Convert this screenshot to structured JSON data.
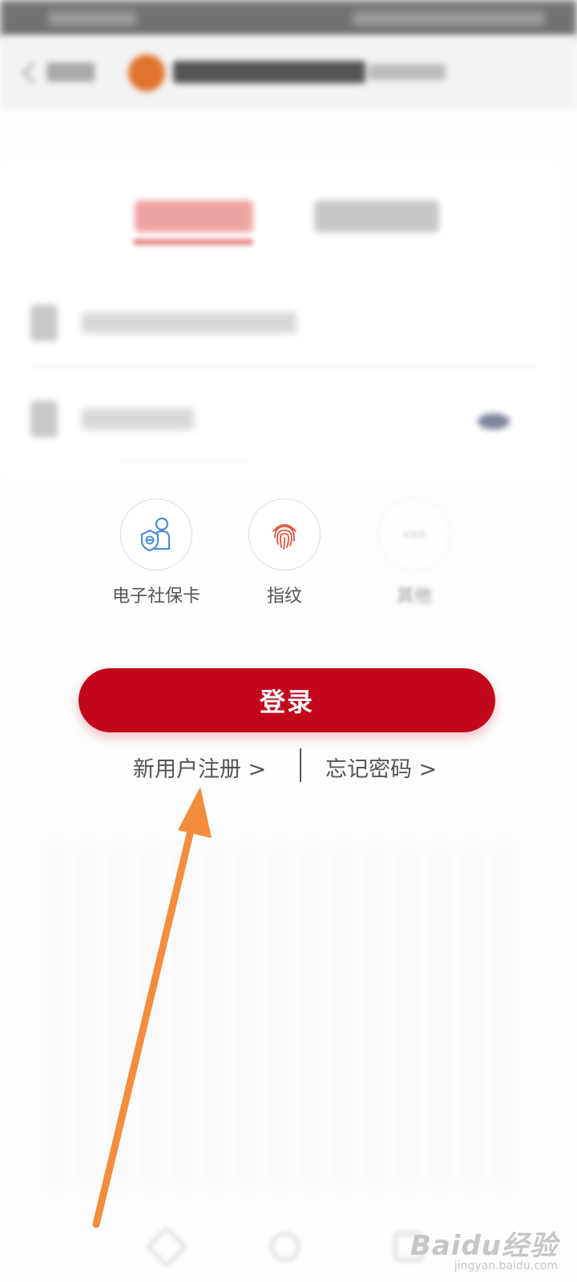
{
  "quick_login": {
    "items": [
      {
        "label": "电子社保卡",
        "icon": "e-social-security-card-icon"
      },
      {
        "label": "指纹",
        "icon": "fingerprint-icon"
      },
      {
        "label": "其他",
        "icon": "more-icon"
      }
    ]
  },
  "login_button": {
    "label": "登录"
  },
  "links": {
    "register": "新用户注册 >",
    "forgot_password": "忘记密码 >"
  },
  "colors": {
    "primary_red": "#c3071b",
    "annotation_arrow": "#f38d3c",
    "link_text": "#555555"
  },
  "watermark": {
    "logo_text": "Baidu经验",
    "url": "jingyan.baidu.com"
  }
}
